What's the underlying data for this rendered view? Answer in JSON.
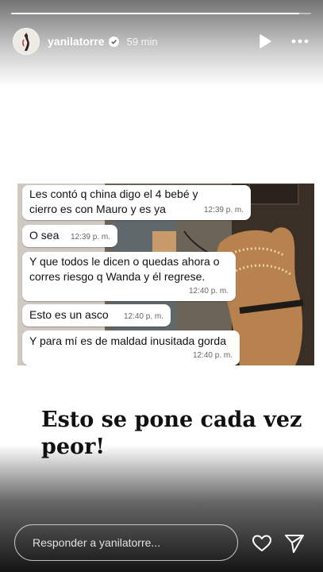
{
  "story": {
    "progress": 0.96,
    "username": "yanilatorre",
    "verified": true,
    "time_ago": "59 min",
    "icons": {
      "play": "play-icon",
      "more": "more-icon",
      "verified": "verified-badge-icon",
      "heart": "heart-icon",
      "send": "send-icon"
    }
  },
  "chat": {
    "messages": [
      {
        "text": "Les contó q china digo el 4 bebé y cierro es con Mauro y es ya",
        "time": "12:39 p. m."
      },
      {
        "text": "O sea",
        "time": "12:39 p. m."
      },
      {
        "text": "Y que todos le dicen o quedas ahora o corres riesgo q Wanda y él regrese.",
        "time": "12:40 p. m."
      },
      {
        "text": "Esto es un asco",
        "time": "12:40 p. m."
      },
      {
        "text": "Y para mí es de maldad inusitada gorda",
        "time": "12:40 p. m."
      }
    ]
  },
  "caption": "Esto se pone cada vez peor!",
  "reply": {
    "placeholder": "Responder a yanilatorre..."
  },
  "colors": {
    "bubble": "#ffffff",
    "timestamp": "#666666",
    "caption": "#111111",
    "background": "#ffffff"
  }
}
